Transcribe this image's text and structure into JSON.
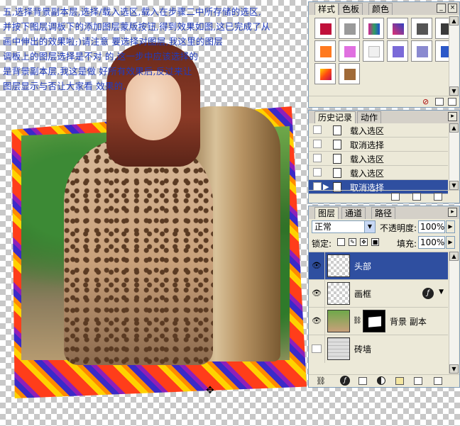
{
  "tutorial": {
    "lines": [
      "五,选择背景副本层,选择/载入选区,载入在步骤二中所存储的选区,",
      "并按下图层调板下的添加图层蒙版按钮,得到效果如图,这已完成了从",
      "画中伸出的效果啦;)请注意            要选择对图层,我这里的图层",
      "调板上的图层选择是不对                    的,这一步中应该选择的",
      "是背景副本层.我这是做                    好所有效果后,反过来让",
      "图层显示与否让大家看                    效果的."
    ]
  },
  "styles_panel": {
    "tabs": [
      "样式",
      "色板",
      "颜色"
    ],
    "swatch_colors": [
      "#c0103a",
      "#9a9a9a",
      "#d02090",
      "#e03070",
      "#555555",
      "#3a3a3a",
      "#ff7a20",
      "#e070e0",
      "#f0f0f0",
      "#7a6ad8",
      "#8a8ad0",
      "#2b58c8",
      "#ff4a10",
      "#a06a38"
    ]
  },
  "history_panel": {
    "tabs": [
      "历史记录",
      "动作"
    ],
    "items": [
      {
        "label": "载入选区"
      },
      {
        "label": "取消选择"
      },
      {
        "label": "载入选区"
      },
      {
        "label": "载入选区"
      },
      {
        "label": "取消选择"
      }
    ]
  },
  "layers_panel": {
    "tabs": [
      "图层",
      "通道",
      "路径"
    ],
    "blend_mode": "正常",
    "opacity_label": "不透明度:",
    "opacity_value": "100%",
    "lock_label": "锁定:",
    "fill_label": "填充:",
    "fill_value": "100%",
    "layers": [
      {
        "name": "头部"
      },
      {
        "name": "画框"
      },
      {
        "name": "背景 副本"
      },
      {
        "name": "砖墙"
      }
    ]
  }
}
